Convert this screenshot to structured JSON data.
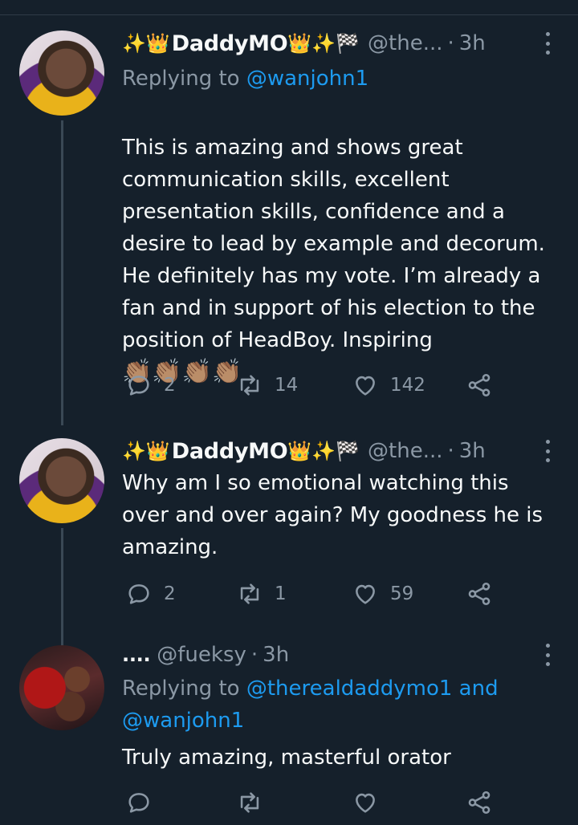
{
  "tweets": [
    {
      "name": "DaddyMO",
      "emoji_before": "✨👑",
      "emoji_after": "👑✨🏁",
      "handle": "@the...",
      "dot": "·",
      "time": "3h",
      "replying_label": "Replying to",
      "replying_to": [
        "@wanjohn1"
      ],
      "text": "This is amazing and shows great communication skills, excellent presentation skills, confidence and a desire to lead by example and decorum. He definitely has my vote. I’m already a fan and in support of his election to the position of HeadBoy. Inspiring",
      "trailing_emoji": "👏🏽👏🏽👏🏽👏🏽",
      "replies": "2",
      "retweets": "14",
      "likes": "142"
    },
    {
      "name": "DaddyMO",
      "emoji_before": "✨👑",
      "emoji_after": "👑✨🏁",
      "handle": "@the...",
      "dot": "·",
      "time": "3h",
      "text": "Why am I so emotional watching this over and over again? My goodness he is amazing.",
      "replies": "2",
      "retweets": "1",
      "likes": "59"
    },
    {
      "name": "....",
      "handle": "@fueksy",
      "dot": "·",
      "time": "3h",
      "replying_label": "Replying to",
      "replying_to": [
        "@therealdaddymo1",
        "@wanjohn1"
      ],
      "replying_joiner": "and",
      "text": "Truly amazing, masterful orator",
      "replies": "",
      "retweets": "",
      "likes": ""
    }
  ],
  "icons": {
    "reply": "reply-icon",
    "retweet": "retweet-icon",
    "like": "heart-icon",
    "share": "share-icon",
    "more": "more-icon"
  },
  "colors": {
    "background": "#15202b",
    "text": "#f7f9f9",
    "muted": "#8b98a5",
    "link": "#1d9bf0",
    "thread_line": "#3a4855"
  }
}
